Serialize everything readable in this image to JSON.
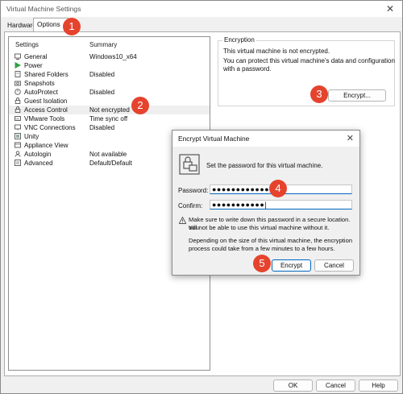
{
  "window": {
    "title": "Virtual Machine Settings",
    "close_icon": "close-icon"
  },
  "tabs": [
    {
      "label": "Hardware"
    },
    {
      "label": "Options"
    }
  ],
  "list": {
    "headers": {
      "settings": "Settings",
      "summary": "Summary"
    },
    "rows": [
      {
        "label": "General",
        "value": "Windows10_x64",
        "icon": "general-icon"
      },
      {
        "label": "Power",
        "value": "",
        "icon": "power-icon"
      },
      {
        "label": "Shared Folders",
        "value": "Disabled",
        "icon": "shared-folders-icon"
      },
      {
        "label": "Snapshots",
        "value": "",
        "icon": "snapshots-icon"
      },
      {
        "label": "AutoProtect",
        "value": "Disabled",
        "icon": "autoprotect-icon"
      },
      {
        "label": "Guest Isolation",
        "value": "",
        "icon": "guest-isolation-icon"
      },
      {
        "label": "Access Control",
        "value": "Not encrypted",
        "icon": "lock-icon"
      },
      {
        "label": "VMware Tools",
        "value": "Time sync off",
        "icon": "vmware-tools-icon"
      },
      {
        "label": "VNC Connections",
        "value": "Disabled",
        "icon": "vnc-icon"
      },
      {
        "label": "Unity",
        "value": "",
        "icon": "unity-icon"
      },
      {
        "label": "Appliance View",
        "value": "",
        "icon": "appliance-view-icon"
      },
      {
        "label": "Autologin",
        "value": "Not available",
        "icon": "autologin-icon"
      },
      {
        "label": "Advanced",
        "value": "Default/Default",
        "icon": "advanced-icon"
      }
    ]
  },
  "encryption": {
    "group_title": "Encryption",
    "status": "This virtual machine is not encrypted.",
    "desc1": "You can protect this virtual machine's data and configuration",
    "desc2": "with a password.",
    "button": "Encrypt..."
  },
  "dialog": {
    "title": "Encrypt Virtual Machine",
    "instruction": "Set the password for this virtual machine.",
    "password_label": "Password:",
    "password_value": "●●●●●●●●●●●●",
    "confirm_label": "Confirm:",
    "confirm_value": "●●●●●●●●●●●|",
    "warning1": "Make sure to write down this password in a secure location. You",
    "warning2": "will not be able to use this virtual machine without it.",
    "info1": "Depending on the size of this virtual machine, the encryption",
    "info2": "process could take from a few minutes to a few hours.",
    "encrypt_button": "Encrypt",
    "cancel_button": "Cancel"
  },
  "footer": {
    "ok": "OK",
    "cancel": "Cancel",
    "help": "Help"
  },
  "badges": [
    "1",
    "2",
    "3",
    "4",
    "5"
  ],
  "colors": {
    "badge": "#e5432e",
    "accent": "#0067c0",
    "power": "#2ea043"
  }
}
